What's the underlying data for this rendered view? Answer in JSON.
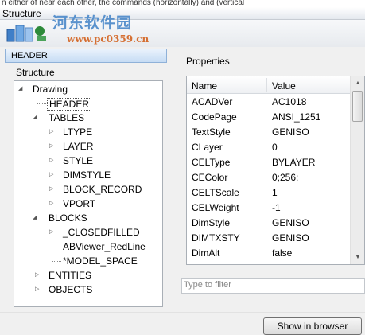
{
  "top_fragment": "n either of near each other, the commands (horizontally) and (vertical",
  "window": {
    "title": "Structure"
  },
  "watermark": {
    "text": "河东软件园",
    "url": "www.pc0359.cn"
  },
  "header_tab": {
    "label": "HEADER"
  },
  "structure": {
    "label": "Structure",
    "root": "Drawing",
    "selected": "HEADER",
    "tables_label": "TABLES",
    "tables": [
      "LTYPE",
      "LAYER",
      "STYLE",
      "DIMSTYLE",
      "BLOCK_RECORD",
      "VPORT"
    ],
    "blocks_label": "BLOCKS",
    "blocks": [
      "_CLOSEDFILLED",
      "ABViewer_RedLine",
      "*MODEL_SPACE"
    ],
    "entities_label": "ENTITIES",
    "objects_label": "OBJECTS"
  },
  "properties": {
    "label": "Properties",
    "columns": {
      "name": "Name",
      "value": "Value"
    },
    "rows": [
      {
        "name": "ACADVer",
        "value": "AC1018"
      },
      {
        "name": "CodePage",
        "value": "ANSI_1251"
      },
      {
        "name": "TextStyle",
        "value": "GENISO"
      },
      {
        "name": "CLayer",
        "value": "0"
      },
      {
        "name": "CELType",
        "value": "BYLAYER"
      },
      {
        "name": "CEColor",
        "value": "0;256;"
      },
      {
        "name": "CELTScale",
        "value": "1"
      },
      {
        "name": "CELWeight",
        "value": "-1"
      },
      {
        "name": "DimStyle",
        "value": "GENISO"
      },
      {
        "name": "DIMTXSTY",
        "value": "GENISO"
      },
      {
        "name": "DimAlt",
        "value": "false"
      }
    ],
    "filter_placeholder": "Type to filter"
  },
  "buttons": {
    "show_in_browser": "Show in browser"
  },
  "colors": {
    "selection_tab": "#c6dcf4",
    "watermark_blue": "#4a88c9",
    "watermark_orange": "#d25a12"
  }
}
